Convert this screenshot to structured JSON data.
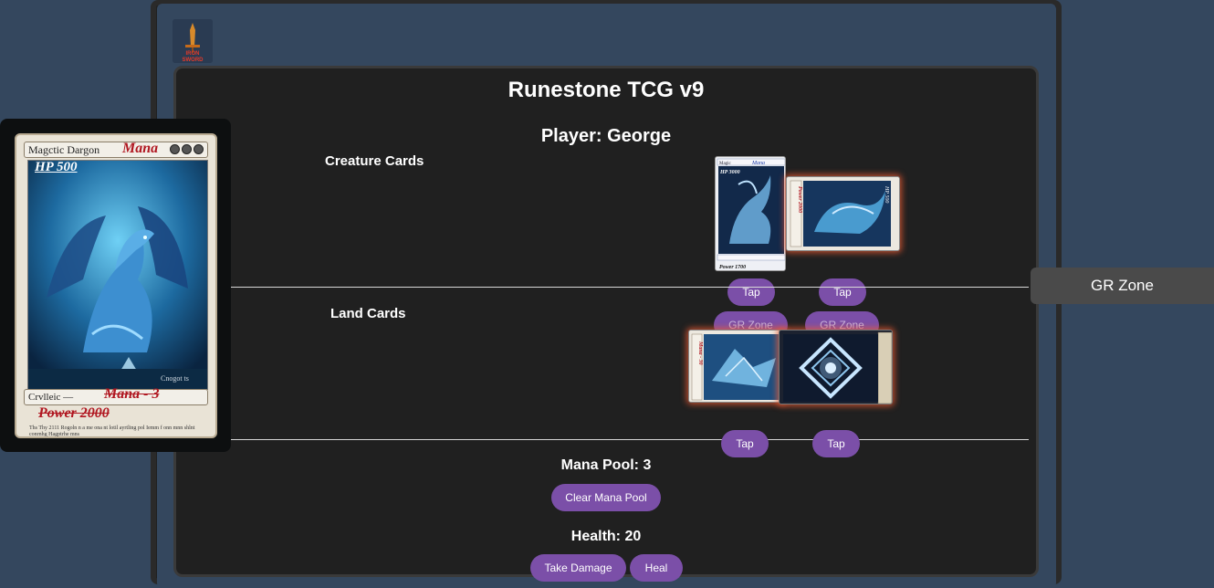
{
  "app": {
    "title": "Runestone TCG v9",
    "logo_text": "IRON SWORD",
    "player_label": "Player: George"
  },
  "sections": {
    "creature_label": "Creature Cards",
    "land_label": "Land Cards"
  },
  "creature_cards": [
    {
      "tap_label": "Tap",
      "gr_zone_label": "GR Zone",
      "orientation": "upright",
      "art_color": "#1b4f86"
    },
    {
      "tap_label": "Tap",
      "gr_zone_label": "GR Zone",
      "orientation": "rotated",
      "art_color": "#1a6aa8"
    }
  ],
  "land_cards": [
    {
      "tap_label": "Tap",
      "orientation": "rotated",
      "art_color": "#2266a0"
    },
    {
      "tap_label": "Tap",
      "orientation": "rotated",
      "art_color": "#1a2e4e"
    }
  ],
  "stats": {
    "mana_pool": "Mana Pool: 3",
    "clear_mana_label": "Clear Mana Pool",
    "health": "Health: 20",
    "take_damage_label": "Take Damage",
    "heal_label": "Heal"
  },
  "side_zone": {
    "label": "GR Zone"
  },
  "preview_card": {
    "name": "Magctic Dargon",
    "mana_tag": "Mana",
    "hp": "HP 500",
    "type_line": "Crvlleic —",
    "cost": "Mana - 3",
    "power": "Power 2000",
    "signature": "Cnogot ts",
    "flavor": "Ths Thy 2111 Rogoln n a me ona nt lotil ayrtling pol Iemm f onn mnn shlnt conrnhg Hagptrhe mns"
  },
  "colors": {
    "accent_purple": "#7b4fa8",
    "panel_bg": "#202020",
    "page_bg": "#34475e",
    "glow": "#eb5a32",
    "mana_red": "#b01620"
  }
}
